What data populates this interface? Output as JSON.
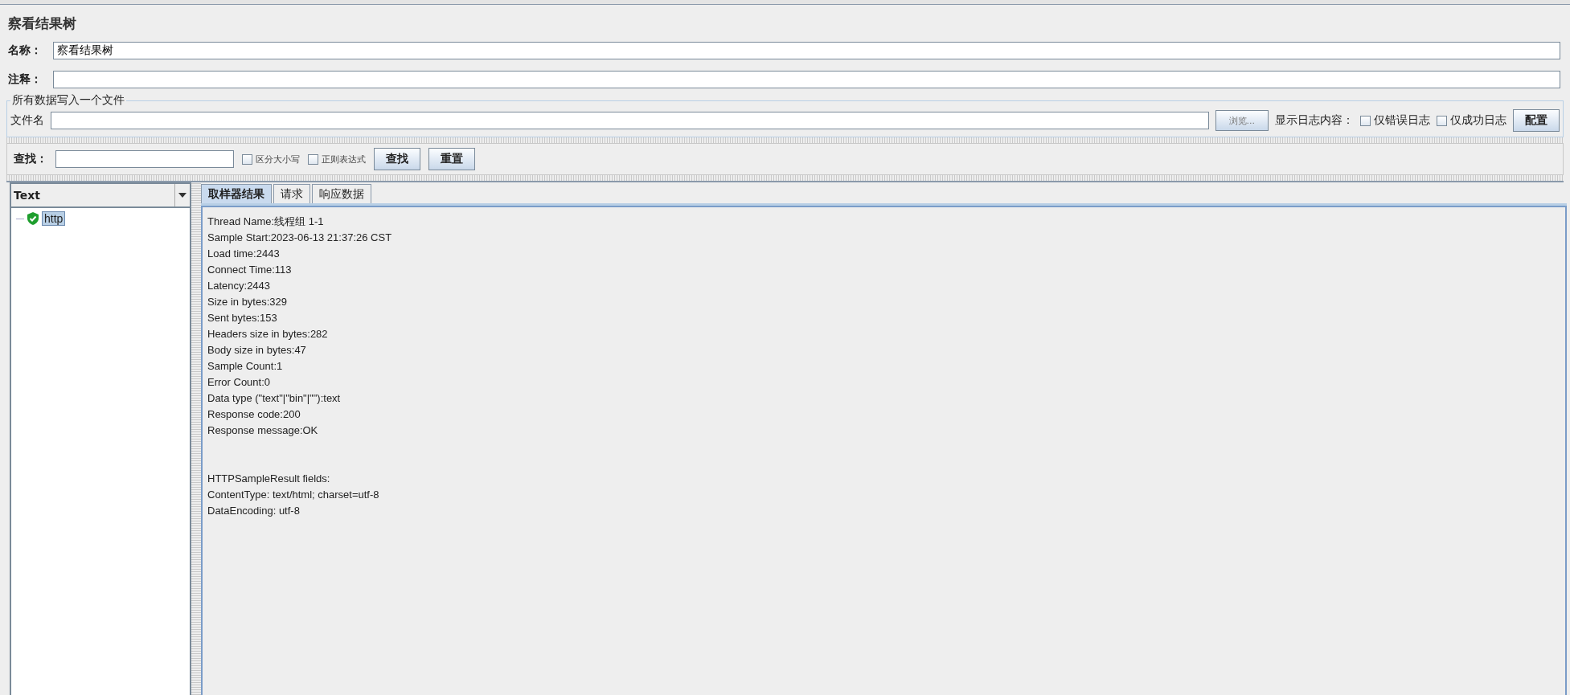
{
  "title": "察看结果树",
  "name_field": {
    "label": "名称：",
    "value": "察看结果树"
  },
  "comment_field": {
    "label": "注释："
  },
  "file_group": {
    "legend": "所有数据写入一个文件",
    "file_label": "文件名",
    "browse_button": "浏览...",
    "log_label": "显示日志内容：",
    "checkboxes": [
      {
        "label": "仅错误日志",
        "checked": false
      },
      {
        "label": "仅成功日志",
        "checked": false
      }
    ],
    "config_button": "配置"
  },
  "search": {
    "label": "查找：",
    "checkboxes": [
      {
        "label": "区分大小写",
        "checked": false
      },
      {
        "label": "正则表达式",
        "checked": false
      }
    ],
    "buttons": [
      "查找",
      "重置"
    ]
  },
  "renderer": {
    "value": "Text"
  },
  "tree": [
    {
      "label": "http",
      "success": true,
      "selected": true
    }
  ],
  "tabs": [
    {
      "label": "取样器结果",
      "selected": true
    },
    {
      "label": "请求",
      "selected": false
    },
    {
      "label": "响应数据",
      "selected": false
    }
  ],
  "result_sections": [
    [
      "Thread Name:线程组 1-1",
      "Sample Start:2023-06-13 21:37:26 CST",
      "Load time:2443",
      "Connect Time:113",
      "Latency:2443",
      "Size in bytes:329",
      "Sent bytes:153",
      "Headers size in bytes:282",
      "Body size in bytes:47",
      "Sample Count:1",
      "Error Count:0",
      "Data type (\"text\"|\"bin\"|\"\"):text",
      "Response code:200",
      "Response message:OK"
    ],
    [
      "HTTPSampleResult fields:",
      "ContentType: text/html; charset=utf-8",
      "DataEncoding: utf-8"
    ]
  ]
}
